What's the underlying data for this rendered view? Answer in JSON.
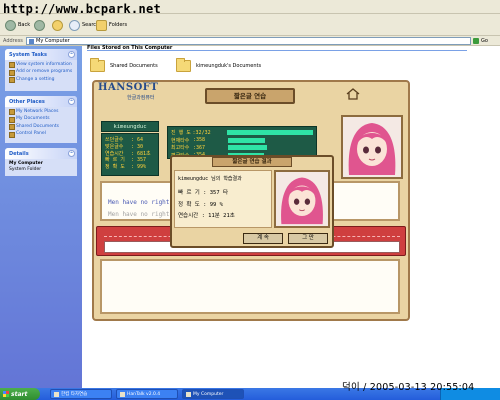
{
  "watermark": "http://www.bcpark.net",
  "toolbar": {
    "back_label": "Back",
    "search_label": "Search",
    "folders_label": "Folders"
  },
  "address": {
    "label": "Address",
    "value": "My Computer",
    "go_label": "Go"
  },
  "sidebar": {
    "system_tasks": {
      "title": "System Tasks",
      "items": [
        {
          "label": "View system information"
        },
        {
          "label": "Add or remove programs"
        },
        {
          "label": "Change a setting"
        }
      ]
    },
    "other_places": {
      "title": "Other Places",
      "items": [
        {
          "label": "My Network Places"
        },
        {
          "label": "My Documents"
        },
        {
          "label": "Shared Documents"
        },
        {
          "label": "Control Panel"
        }
      ]
    },
    "details": {
      "title": "Details",
      "name": "My Computer",
      "type": "System Folder"
    }
  },
  "files": {
    "header": "Files Stored on This Computer",
    "folders": [
      {
        "label": "Shared Documents"
      },
      {
        "label": "kimeungduk's Documents"
      }
    ]
  },
  "game": {
    "logo": "HANSOFT",
    "logo_sub": "한글과컴퓨터",
    "title": "짧은글 연습",
    "player_name": "kimeungduc",
    "left_stats": [
      {
        "key": "쓰던글수",
        "value": "64"
      },
      {
        "key": "맞은글수",
        "value": "30"
      },
      {
        "key": "연습시간",
        "value": "681초"
      },
      {
        "key": "빠 르 기",
        "value": "357"
      },
      {
        "key": "정 확 도",
        "value": "99%"
      }
    ],
    "mid_stats": [
      {
        "key": "진 행 도",
        "value": "32/32",
        "fill": 1.0
      },
      {
        "key": "현재타수",
        "value": "358",
        "fill": 0.42
      },
      {
        "key": "최고타수",
        "value": "367",
        "fill": 0.44
      },
      {
        "key": "평균타수",
        "value": "354",
        "fill": 0.41
      }
    ],
    "text_line1": "Men have no right to",
    "text_line2": "Men have no right to"
  },
  "dialog": {
    "title": "짧은글 연습 결과",
    "result_head": "kimeungduc 님의 학습결과",
    "rows": [
      {
        "key": "빠 르 기",
        "value": ": 357 타"
      },
      {
        "key": "정 확 도",
        "value": ": 99 %"
      },
      {
        "key": "연습시간",
        "value": ": 11분 21초"
      }
    ],
    "continue_label": "계  속",
    "quit_label": "그  만"
  },
  "taskbar": {
    "start_label": "start",
    "tasks": [
      {
        "label": "한컴 타자연습"
      },
      {
        "label": "HanTalk v2.0.4"
      },
      {
        "label": "My Computer"
      }
    ]
  },
  "timestamp": "덕이 / 2005-03-13 20:55:04",
  "colors": {
    "sidebar_blue": "#6375d6",
    "game_bg": "#ead4a3",
    "stat_panel": "#1e5a46",
    "stat_text": "#ffd23a",
    "bar_fill": "#2fe3a6",
    "input_band": "#cf3f3f"
  }
}
